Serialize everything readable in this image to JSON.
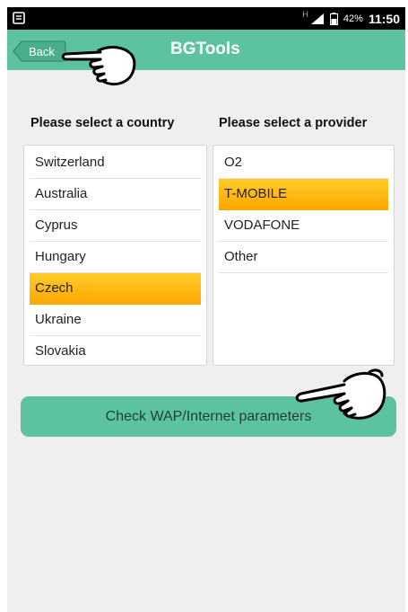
{
  "status_bar": {
    "network_indicator": "H",
    "battery": "42%",
    "time": "11:50",
    "icons": [
      "notification-icon",
      "signal-icon",
      "battery-icon"
    ]
  },
  "app_bar": {
    "back_label": "Back",
    "title": "BGTools"
  },
  "country_column": {
    "header": "Please select a country",
    "items": [
      {
        "label": "Switzerland",
        "selected": false
      },
      {
        "label": "Australia",
        "selected": false
      },
      {
        "label": "Cyprus",
        "selected": false
      },
      {
        "label": "Hungary",
        "selected": false
      },
      {
        "label": "Czech",
        "selected": true
      },
      {
        "label": "Ukraine",
        "selected": false
      },
      {
        "label": "Slovakia",
        "selected": false
      }
    ]
  },
  "provider_column": {
    "header": "Please select a provider",
    "items": [
      {
        "label": "O2",
        "selected": false
      },
      {
        "label": "T-MOBILE",
        "selected": true
      },
      {
        "label": "VODAFONE",
        "selected": false
      },
      {
        "label": "Other",
        "selected": false
      }
    ]
  },
  "action": {
    "check_label": "Check WAP/Internet parameters"
  },
  "colors": {
    "accent": "#5cc2a0",
    "selection": "#ffb000",
    "background": "#efefef"
  }
}
